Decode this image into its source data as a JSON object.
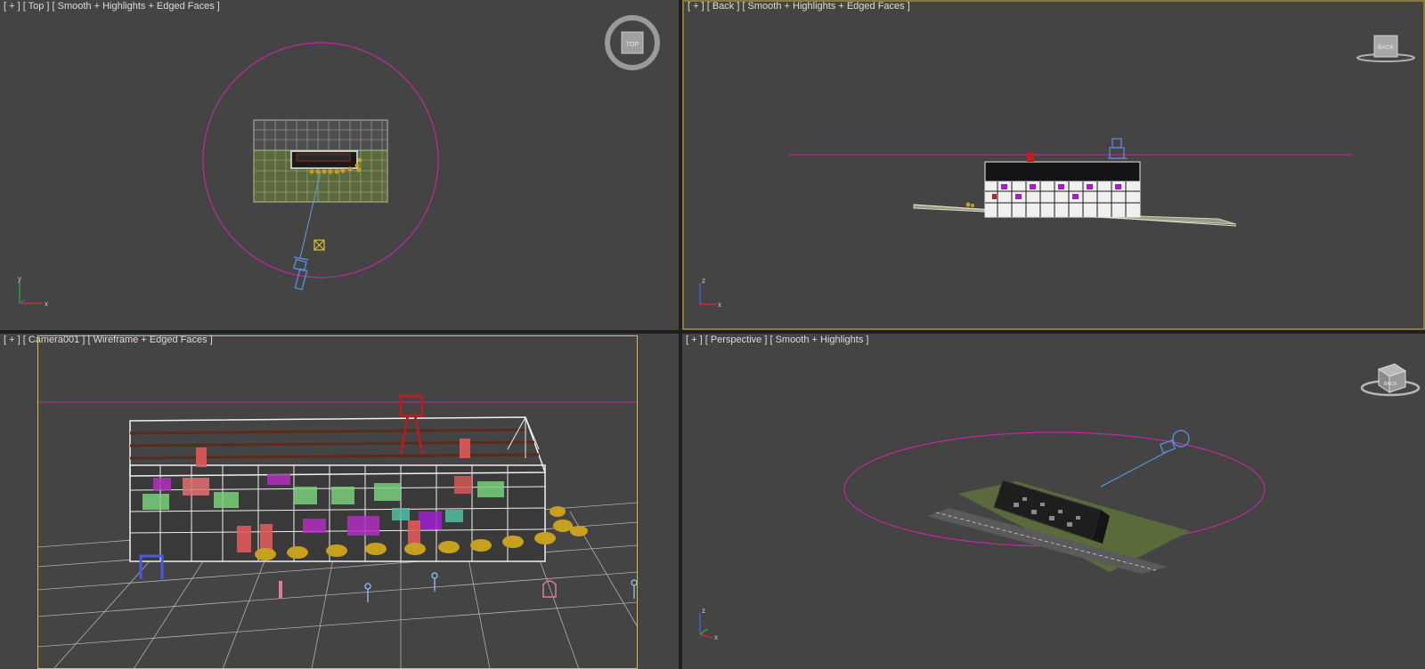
{
  "viewports": {
    "top": {
      "label": "[ + ] [ Top ] [ Smooth + Highlights + Edged Faces ]",
      "navcube_label": "TOP",
      "axis_labels": {
        "vertical": "y",
        "horizontal": "x"
      }
    },
    "back": {
      "label": "[ + ] [ Back ] [ Smooth + Highlights + Edged Faces ]",
      "navcube_label": "BACK",
      "axis_labels": {
        "vertical": "z",
        "horizontal": "x"
      }
    },
    "camera": {
      "label": "[ + ] [ Camera001 ] [ Wireframe + Edged Faces ]"
    },
    "perspective": {
      "label": "[ + ] [ Perspective ] [ Smooth + Highlights ]",
      "navcube_label": "BACK",
      "axis_labels": {
        "vertical": "z",
        "horizontal": "x"
      }
    }
  },
  "colors": {
    "viewport_bg": "#444444",
    "active_border": "#8a7a3a",
    "camera_frame": "#d8c23a",
    "light_circle": "#c02aa0",
    "camera_object": "#5a8ad8",
    "foliage": "#c8a020",
    "grass": "#6a7a3a"
  }
}
